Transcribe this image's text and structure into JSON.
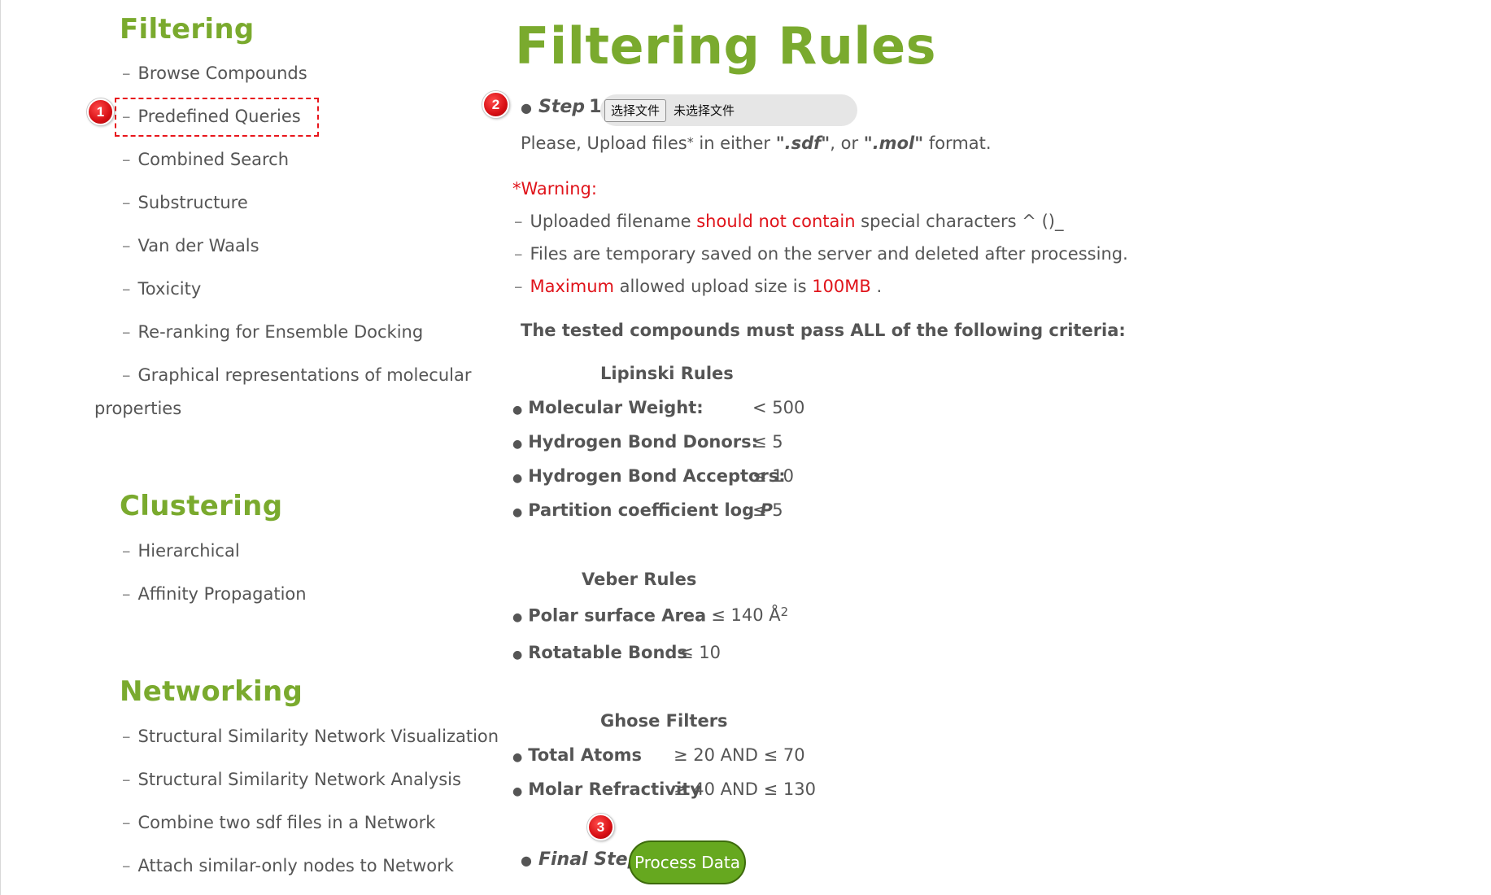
{
  "sidebar": {
    "filtering": {
      "title": "Filtering",
      "items": [
        "Browse Compounds",
        "Predefined Queries",
        "Combined Search",
        "Substructure",
        "Van der Waals",
        "Toxicity",
        "Re-ranking for Ensemble Docking",
        "Graphical representations of molecular",
        "properties"
      ]
    },
    "clustering": {
      "title": "Clustering",
      "items": [
        "Hierarchical",
        "Affinity Propagation"
      ]
    },
    "networking": {
      "title": "Networking",
      "items": [
        "Structural Similarity Network Visualization",
        "Structural Similarity Network Analysis",
        "Combine two sdf files in a Network",
        "Attach similar-only nodes to Network"
      ]
    },
    "dash": "–"
  },
  "annotations": [
    "1",
    "2",
    "3"
  ],
  "main": {
    "title": "Filtering Rules",
    "step1": {
      "label": "Step",
      "number": "1.",
      "file_button": "选择文件",
      "file_status": "未选择文件",
      "instruction_pre": "Please, Upload files",
      "asterisk": "*",
      "instruction_mid": " in either ",
      "sdf": "\".sdf\"",
      "comma_or": ", or ",
      "mol": "\".mol\"",
      "instruction_post": " format."
    },
    "warning": {
      "heading": "*Warning:",
      "line1_pre": "Uploaded filename ",
      "line1_red": "should not contain",
      "line1_post": " special characters ^ ()_",
      "line2": "Files are temporary saved on the server and deleted after processing.",
      "line3_red1": "Maximum",
      "line3_mid": " allowed upload size is ",
      "line3_red2": "100MB",
      "line3_post": " ."
    },
    "criteria_heading": "The tested compounds must pass ALL of the following criteria:",
    "lipinski": {
      "heading": "Lipinski Rules",
      "rules": [
        {
          "name": "Molecular Weight:",
          "value": "< 500"
        },
        {
          "name": "Hydrogen Bond Donors:",
          "value": "≤ 5"
        },
        {
          "name": "Hydrogen Bond Acceptors:",
          "value": "≤ 10"
        },
        {
          "name": "Partition coefficient log ",
          "name_italic": "P",
          "value": "≤ 5"
        }
      ]
    },
    "veber": {
      "heading": "Veber Rules",
      "rules": [
        {
          "name": "Polar surface Area",
          "value": "≤ 140 Å",
          "sup": "2"
        },
        {
          "name": "Rotatable Bonds",
          "value": "≤ 10"
        }
      ]
    },
    "ghose": {
      "heading": "Ghose Filters",
      "rules": [
        {
          "name": "Total Atoms",
          "value": "≥ 20 AND ≤ 70"
        },
        {
          "name": "Molar Refractivity",
          "value": "≥ 40 AND ≤ 130"
        }
      ]
    },
    "final_step": {
      "label": "Final Step.",
      "button": "Process Data"
    }
  },
  "colors": {
    "brand_green": "#7aaa2e",
    "button_green": "#66a81f",
    "warning_red": "#e0141b",
    "text_gray": "#555555"
  }
}
